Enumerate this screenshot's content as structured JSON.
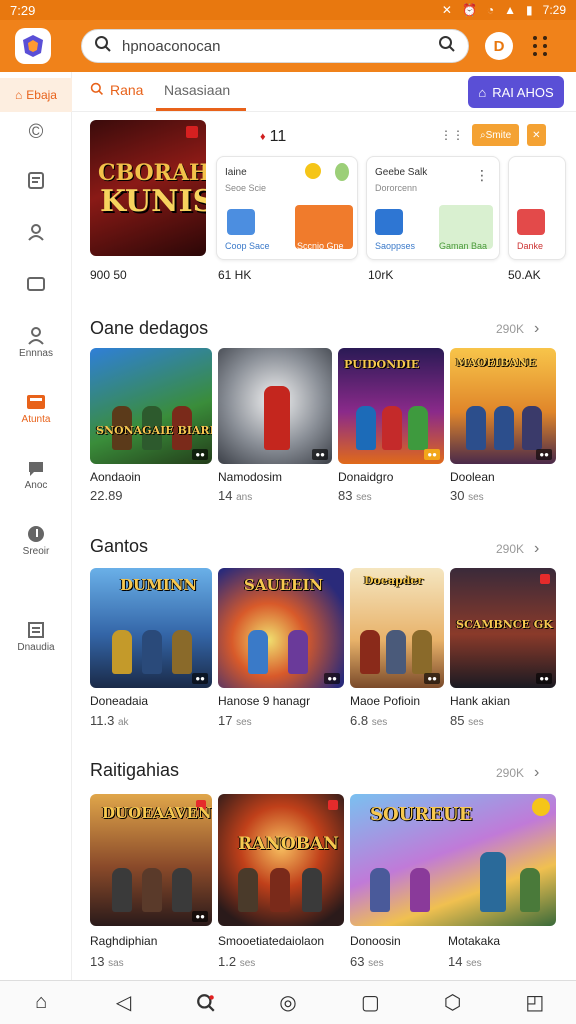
{
  "status_bar": {
    "time_left": "7:29",
    "time_right": "7:29"
  },
  "app": {
    "search_placeholder": "hpnoaconocan",
    "profile_initial": "D",
    "brand_color": "#f0821a"
  },
  "sidebar": {
    "top_label": "Ebaja",
    "items": [
      {
        "label": "",
        "icon": "copyright-circle-icon"
      },
      {
        "label": "",
        "icon": "clipboard-icon"
      },
      {
        "label": "",
        "icon": "user-icon"
      },
      {
        "label": "",
        "icon": "tablet-icon"
      },
      {
        "label": "Ennnas",
        "icon": "person-group-icon"
      },
      {
        "label": "Atunta",
        "icon": "inbox-icon"
      },
      {
        "label": "Anoc",
        "icon": "chat-bubble-icon"
      },
      {
        "label": "Sreoir",
        "icon": "music-note-icon"
      },
      {
        "label": "Dnaudia",
        "icon": "document-list-icon"
      }
    ]
  },
  "tabs": {
    "tab1": "Rana",
    "tab2": "Nasasiaan",
    "cta": "RAI AHOS"
  },
  "featured": {
    "title_top": "CBORAH",
    "title_main": "KUNIS",
    "count": "11",
    "action_label": "Smite",
    "stats": [
      "900 50",
      "61 HK",
      "10rK",
      "50.AK"
    ]
  },
  "quick_cards": [
    {
      "title": "Iaine",
      "subtitle": "Seoe Scie",
      "tiles": [
        "Coop Sace",
        "Sccnio Gne"
      ]
    },
    {
      "title": "Geebe Salk",
      "subtitle": "Dororcenn",
      "tiles": [
        "Saoppses",
        "Gaman Baa"
      ]
    },
    {
      "title": "",
      "subtitle": "",
      "tiles": [
        "Danke"
      ]
    }
  ],
  "sections": [
    {
      "title": "Oane dedagos",
      "count": "290K",
      "games": [
        {
          "art_title": "SNONAGAIE BIAREAK",
          "name": "Aondaoin",
          "size": "22.89",
          "unit": ""
        },
        {
          "art_title": "",
          "name": "Namodosim",
          "size": "14",
          "unit": "ans"
        },
        {
          "art_title": "PUIDONDIE",
          "name": "Donaidgro",
          "size": "83",
          "unit": "ses"
        },
        {
          "art_title": "MAOEIBANE",
          "name": "Doolean",
          "size": "30",
          "unit": "ses"
        }
      ]
    },
    {
      "title": "Gantos",
      "count": "290K",
      "games": [
        {
          "art_title": "DUMINN",
          "name": "Doneadaia",
          "size": "11.3",
          "unit": "ak"
        },
        {
          "art_title": "SAUEEIN",
          "name": "Hanose 9 hanagr",
          "size": "17",
          "unit": "ses"
        },
        {
          "art_title": "Doeapder",
          "name": "Maoe Pofioin",
          "size": "6.8",
          "unit": "ses"
        },
        {
          "art_title": "SCAMBNCE GK",
          "name": "Hank akian",
          "size": "85",
          "unit": "ses"
        }
      ]
    },
    {
      "title": "Raitigahias",
      "count": "290K",
      "games": [
        {
          "art_title": "DUOEAAVEN",
          "name": "Raghdiphian",
          "size": "13",
          "unit": "sas"
        },
        {
          "art_title": "RANOBAN",
          "name": "Smooetiatedaiolaon",
          "size": "1.2",
          "unit": "ses"
        },
        {
          "art_title": "SOUREUE",
          "name": "Donoosin",
          "size": "63",
          "unit": "ses"
        },
        {
          "art_title": "",
          "name": "Motakaka",
          "size": "14",
          "unit": "ses"
        }
      ]
    }
  ],
  "navbar": [
    "home-icon",
    "back-icon",
    "search-icon",
    "circle-icon",
    "square-icon",
    "cube-icon",
    "window-icon"
  ]
}
